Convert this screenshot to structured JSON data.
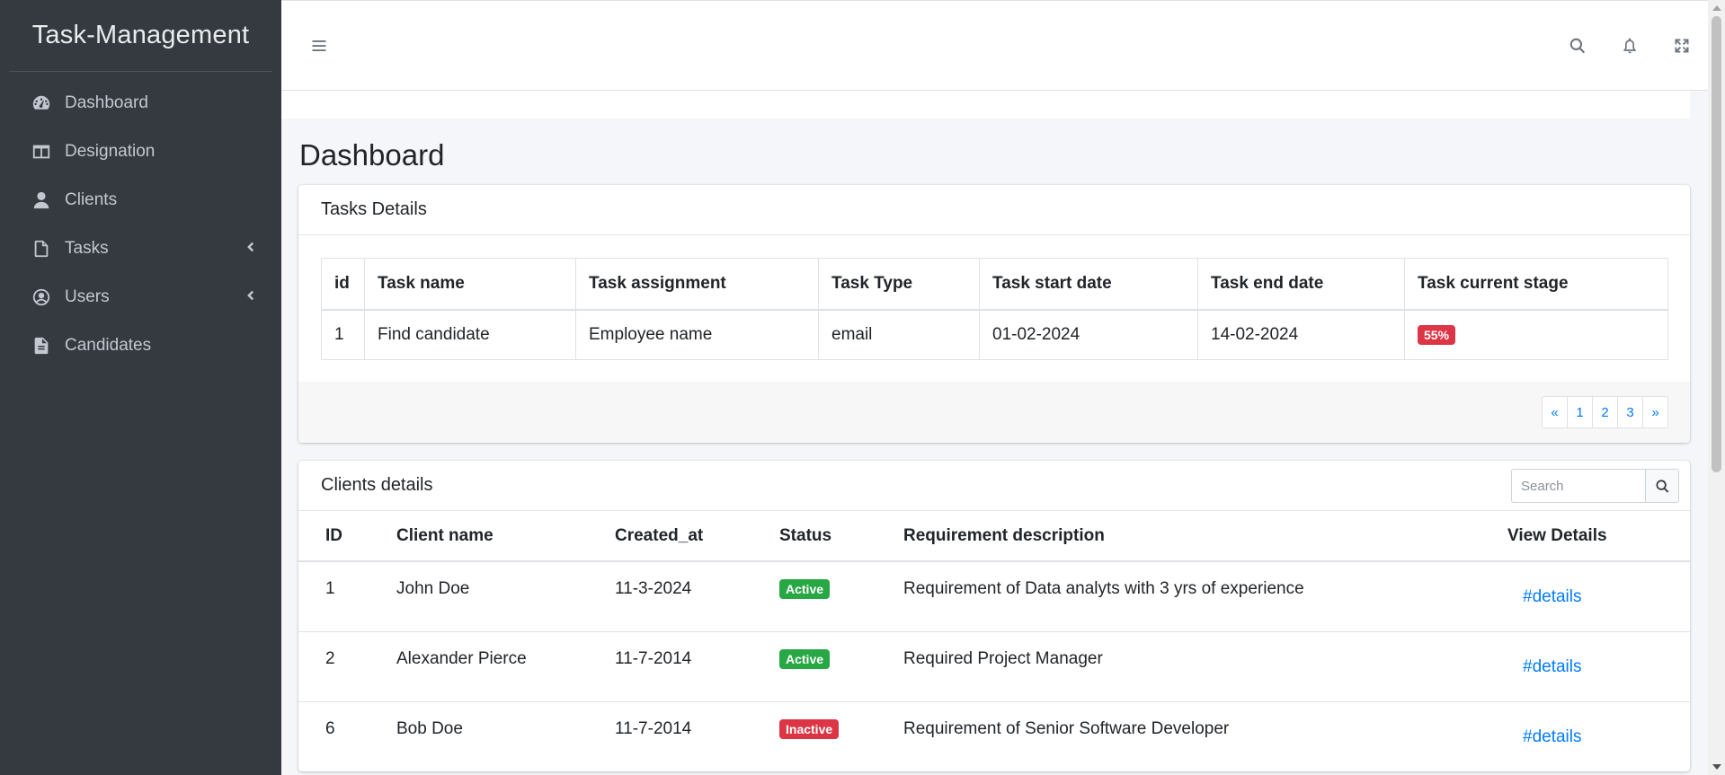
{
  "sidebar": {
    "brand": "Task-Management",
    "items": [
      {
        "label": "Dashboard",
        "icon": "dashboard-icon"
      },
      {
        "label": "Designation",
        "icon": "columns-icon"
      },
      {
        "label": "Clients",
        "icon": "user-icon"
      },
      {
        "label": "Tasks",
        "icon": "file-icon",
        "has_arrow": true
      },
      {
        "label": "Users",
        "icon": "user-circle-icon",
        "has_arrow": true
      },
      {
        "label": "Candidates",
        "icon": "file-text-icon"
      }
    ]
  },
  "navbar": {
    "icons": [
      "menu-icon",
      "search-icon",
      "bell-icon",
      "expand-icon"
    ]
  },
  "page": {
    "title": "Dashboard"
  },
  "tasks": {
    "title": "Tasks Details",
    "columns": [
      "id",
      "Task name",
      "Task assignment",
      "Task Type",
      "Task start date",
      "Task end date",
      "Task current stage"
    ],
    "rows": [
      {
        "id": "1",
        "name": "Find candidate",
        "assignment": "Employee name",
        "type": "email",
        "start": "01-02-2024",
        "end": "14-02-2024",
        "stage": "55%"
      }
    ],
    "pagination": [
      "«",
      "1",
      "2",
      "3",
      "»"
    ]
  },
  "clients": {
    "title": "Clients details",
    "search_placeholder": "Search",
    "columns": [
      "ID",
      "Client name",
      "Created_at",
      "Status",
      "Requirement description",
      "View Details"
    ],
    "rows": [
      {
        "id": "1",
        "name": "John Doe",
        "created": "11-3-2024",
        "status": "Active",
        "desc": "Requirement of Data analyts with 3 yrs of experience",
        "link": "#details"
      },
      {
        "id": "2",
        "name": "Alexander Pierce",
        "created": "11-7-2014",
        "status": "Active",
        "desc": "Required Project Manager",
        "link": "#details"
      },
      {
        "id": "6",
        "name": "Bob Doe",
        "created": "11-7-2014",
        "status": "Inactive",
        "desc": "Requirement of Senior Software Developer",
        "link": "#details"
      }
    ]
  },
  "colors": {
    "sidebar_bg": "#343a40",
    "accent": "#007bff",
    "success": "#28a745",
    "danger": "#dc3545"
  }
}
